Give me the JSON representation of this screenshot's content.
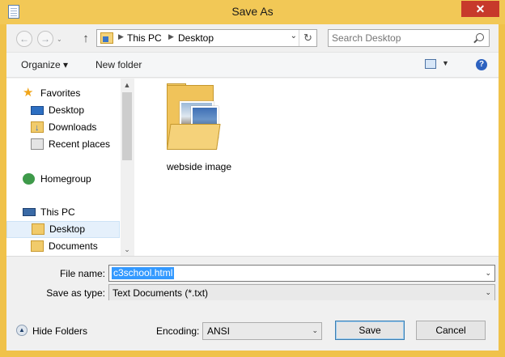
{
  "window": {
    "title": "Save As",
    "close_glyph": "✕"
  },
  "address": {
    "back_glyph": "←",
    "forward_glyph": "→",
    "up_glyph": "↑",
    "crumbs": [
      "This PC",
      "Desktop"
    ],
    "separator_glyph": "▶",
    "dropdown_glyph": "⌄",
    "refresh_glyph": "↻"
  },
  "search": {
    "placeholder": "Search Desktop"
  },
  "toolbar": {
    "organize_label": "Organize ▾",
    "new_folder_label": "New folder",
    "view_dropdown_glyph": "▼",
    "help_glyph": "?"
  },
  "nav": {
    "favorites": "Favorites",
    "desktop": "Desktop",
    "downloads": "Downloads",
    "recent_places": "Recent places",
    "homegroup": "Homegroup",
    "this_pc": "This PC",
    "desktop_selected": "Desktop",
    "documents": "Documents",
    "scroll_up_glyph": "▲",
    "scroll_down_glyph": "⌄"
  },
  "content": {
    "items": [
      {
        "name": "webside image",
        "icon": "folder-with-photos-icon"
      }
    ]
  },
  "fields": {
    "file_name_label": "File name:",
    "file_name_value": "c3school.html",
    "save_as_type_label": "Save as type:",
    "save_as_type_value": "Text Documents (*.txt)",
    "dropdown_glyph": "⌄"
  },
  "bottom": {
    "hide_folders_glyph": "▲",
    "hide_folders_label": "Hide Folders",
    "encoding_label": "Encoding:",
    "encoding_value": "ANSI",
    "save_label": "Save",
    "cancel_label": "Cancel"
  },
  "colors": {
    "title_bar": "#f2c856",
    "close_button": "#c7392b",
    "selection": "#3399ff",
    "nav_selected": "#e5f0fb"
  }
}
